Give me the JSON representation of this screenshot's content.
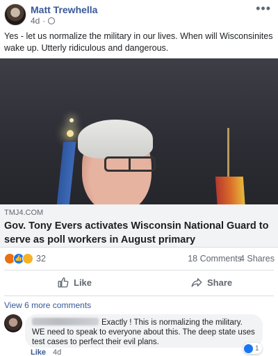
{
  "post": {
    "author": "Matt Trewhella",
    "time": "4d",
    "more_icon": "•••",
    "text": "Yes - let us normalize the military in our lives. When will Wisconsinites wake up. Utterly ridiculous and dangerous."
  },
  "link": {
    "domain": "TMJ4.COM",
    "headline": "Gov. Tony Evers activates Wisconsin National Guard to serve as poll workers in August primary",
    "info_icon": "i"
  },
  "stats": {
    "reaction_count": "32",
    "reactions": [
      "angry",
      "like",
      "wow"
    ],
    "comments": "18 Comments",
    "shares": "4 Shares"
  },
  "actions": {
    "like": "Like",
    "share": "Share"
  },
  "comments": {
    "view_more": "View 6 more comments",
    "items": [
      {
        "text": "Exactly ! This is normalizing the military. WE need to speak to everyone about this. The deep state uses test cases to perfect their evil plans.",
        "reaction_count": "1",
        "like_label": "Like",
        "time": "4d"
      }
    ]
  },
  "colors": {
    "link_blue": "#385898",
    "facebook_blue": "#1877f2",
    "muted_text": "#606770",
    "link_box_bg": "#f2f3f5"
  }
}
